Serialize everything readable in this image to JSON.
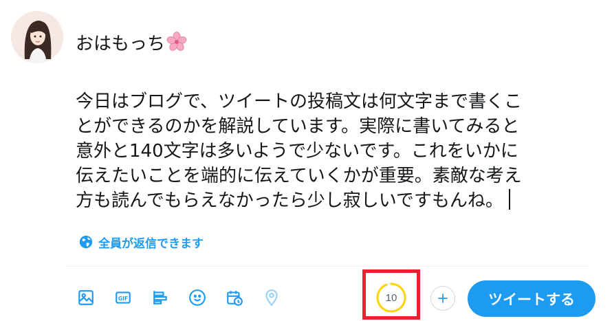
{
  "compose": {
    "lines": [
      "おはもっち",
      "今日はブログで、ツイートの投稿文は何文字まで書くこ",
      "とができるのかを解説しています。実際に書いてみると",
      "意外と140文字は多いようで少ないです。これをいかに",
      "伝えたいことを端的に伝えていくかが重要。素敵な考え",
      "方も読んでもらえなかったら少し寂しいですもんね。"
    ],
    "emoji": "cherry-blossom-icon"
  },
  "reply_setting": {
    "label": "全員が返信できます",
    "icon": "globe-icon"
  },
  "toolbar": {
    "icons": [
      "image-icon",
      "gif-icon",
      "poll-icon",
      "emoji-icon",
      "schedule-icon",
      "location-icon"
    ],
    "gif_label": "GIF"
  },
  "counter": {
    "value": "10",
    "progress": 0.94,
    "color": "#ffd400",
    "track_color": "#eff3f4"
  },
  "tweet_button": {
    "label": "ツイートする"
  },
  "colors": {
    "accent": "#1d9bf0",
    "highlight": "#e8232f",
    "text": "#14171a",
    "muted": "#536471"
  }
}
